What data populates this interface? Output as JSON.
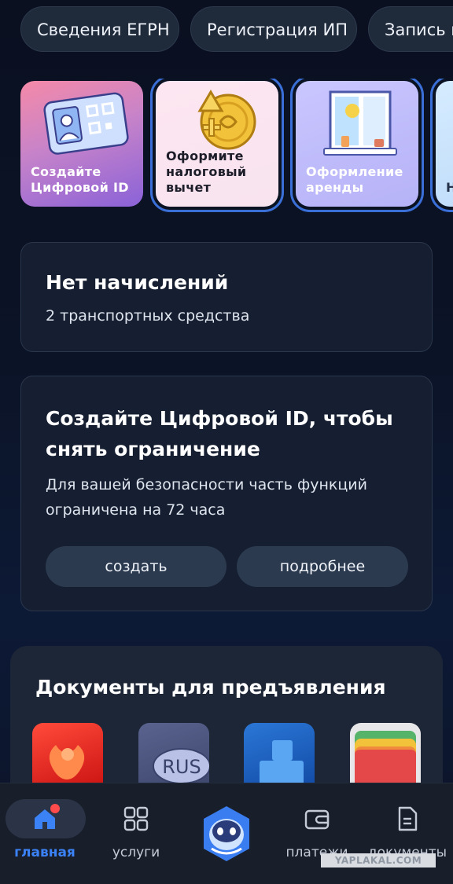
{
  "chips": [
    "Сведения ЕГРН",
    "Регистрация ИП",
    "Запись к"
  ],
  "stories": [
    {
      "label": "Создайте Цифровой ID"
    },
    {
      "label": "Оформите налоговый вычет"
    },
    {
      "label": "Оформление аренды"
    },
    {
      "label": "Н б"
    }
  ],
  "charges": {
    "title": "Нет начислений",
    "subtitle": "2 транспортных средства"
  },
  "digital_id": {
    "title": "Создайте Цифровой ID, чтобы снять ограничение",
    "description": "Для вашей безопасности часть функций ограничена на 72 часа",
    "create_label": "создать",
    "more_label": "подробнее"
  },
  "documents": {
    "title": "Документы для предъявления",
    "items": [
      {
        "icon": "passport-eagle-icon"
      },
      {
        "icon": "license-rus-icon"
      },
      {
        "icon": "blue-blocks-icon"
      },
      {
        "icon": "wallet-cards-icon"
      }
    ]
  },
  "nav": {
    "home": "главная",
    "services": "услуги",
    "payments": "платежи",
    "documents": "документы"
  },
  "watermark": "YAPLAKAL.COM",
  "colors": {
    "accent": "#3b82f6",
    "notification": "#ff4b4b",
    "card": "#161f31"
  }
}
